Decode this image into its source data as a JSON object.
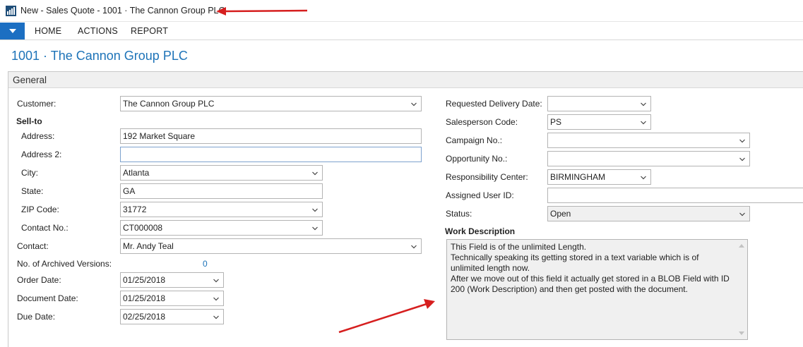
{
  "window": {
    "title": "New - Sales Quote - 1001 · The Cannon Group PLC",
    "app_icon": "chart-icon"
  },
  "ribbon": {
    "tabs": [
      "HOME",
      "ACTIONS",
      "REPORT"
    ]
  },
  "page_title": "1001 · The Cannon Group PLC",
  "section": {
    "title": "General"
  },
  "left": {
    "customer_label": "Customer:",
    "customer_value": "The Cannon Group PLC",
    "sellto_label": "Sell-to",
    "address_label": "Address:",
    "address_value": "192 Market Square",
    "address2_label": "Address 2:",
    "address2_value": "",
    "city_label": "City:",
    "city_value": "Atlanta",
    "state_label": "State:",
    "state_value": "GA",
    "zip_label": "ZIP Code:",
    "zip_value": "31772",
    "contactno_label": "Contact No.:",
    "contactno_value": "CT000008",
    "contact_label": "Contact:",
    "contact_value": "Mr. Andy Teal",
    "archived_label": "No. of Archived Versions:",
    "archived_value": "0",
    "orderdate_label": "Order Date:",
    "orderdate_value": "01/25/2018",
    "docdate_label": "Document Date:",
    "docdate_value": "01/25/2018",
    "duedate_label": "Due Date:",
    "duedate_value": "02/25/2018"
  },
  "right": {
    "reqdelivery_label": "Requested Delivery Date:",
    "reqdelivery_value": "",
    "salesperson_label": "Salesperson Code:",
    "salesperson_value": "PS",
    "campaign_label": "Campaign No.:",
    "campaign_value": "",
    "opportunity_label": "Opportunity No.:",
    "opportunity_value": "",
    "respcenter_label": "Responsibility Center:",
    "respcenter_value": "BIRMINGHAM",
    "assigneduser_label": "Assigned User ID:",
    "assigneduser_value": "",
    "status_label": "Status:",
    "status_value": "Open",
    "workdesc_label": "Work Description",
    "workdesc_lines": [
      "This Field is of the unlimited Length.",
      "Technically speaking its getting stored in a text variable which is of",
      "unlimited length now.",
      "After we move out of this field it actually get stored in a BLOB Field with ID",
      "200 (Work Description) and then get posted with the document."
    ]
  },
  "annotations": {
    "arrow_color": "#d61f1f"
  }
}
